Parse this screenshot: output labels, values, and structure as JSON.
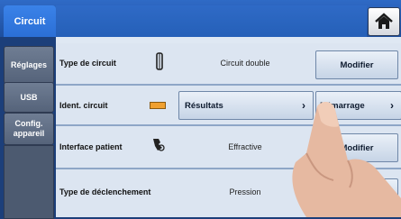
{
  "tabs": {
    "active": "Circuit"
  },
  "sidebar": {
    "items": [
      {
        "label": "Réglages"
      },
      {
        "label": "USB"
      },
      {
        "label": "Config.\nappareil"
      }
    ]
  },
  "rows": [
    {
      "label": "Type de circuit",
      "value": "Circuit double",
      "button": "Modifier"
    },
    {
      "label": "Ident. circuit",
      "button_left": "Résultats",
      "button_right": "Démarrage"
    },
    {
      "label": "Interface patient",
      "value": "Effractive",
      "button": "Modifier"
    },
    {
      "label": "Type de déclenchement",
      "value": "Pression"
    }
  ],
  "icons": {
    "home": "home-icon",
    "circuit": "tube-icon",
    "ident": "orange-bar-icon",
    "interface": "mask-icon"
  },
  "colors": {
    "accent": "#2b6fd6",
    "indicator": "#f0a030"
  }
}
